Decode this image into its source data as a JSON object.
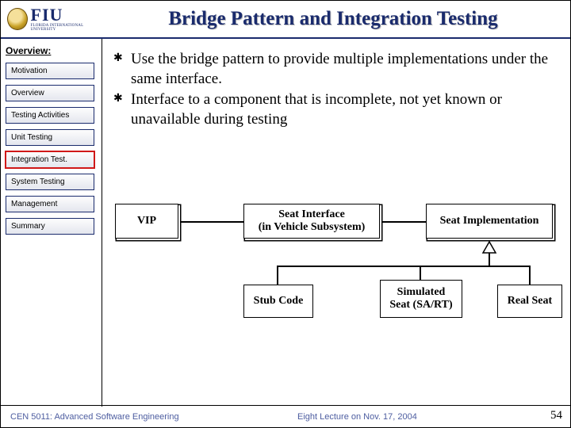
{
  "header": {
    "logo_main": "FIU",
    "logo_sub": "FLORIDA INTERNATIONAL UNIVERSITY",
    "title": "Bridge Pattern and Integration Testing"
  },
  "sidebar": {
    "heading": "Overview:",
    "items": [
      {
        "label": "Motivation"
      },
      {
        "label": "Overview"
      },
      {
        "label": "Testing Activities"
      },
      {
        "label": "Unit Testing"
      },
      {
        "label": "Integration Test."
      },
      {
        "label": "System Testing"
      },
      {
        "label": "Management"
      },
      {
        "label": "Summary"
      }
    ],
    "active_index": 4
  },
  "bullets": [
    "Use the bridge pattern to provide multiple implementations under the same interface.",
    "Interface to a component that is incomplete, not yet known or unavailable during testing"
  ],
  "diagram": {
    "vip": "VIP",
    "seat_if_l1": "Seat Interface",
    "seat_if_l2": "(in Vehicle Subsystem)",
    "seat_impl": "Seat Implementation",
    "stub": "Stub Code",
    "sim_l1": "Simulated",
    "sim_l2": "Seat (SA/RT)",
    "real": "Real Seat"
  },
  "footer": {
    "left": "CEN 5011: Advanced Software Engineering",
    "mid": "Eight Lecture on Nov. 17, 2004",
    "page": "54"
  }
}
